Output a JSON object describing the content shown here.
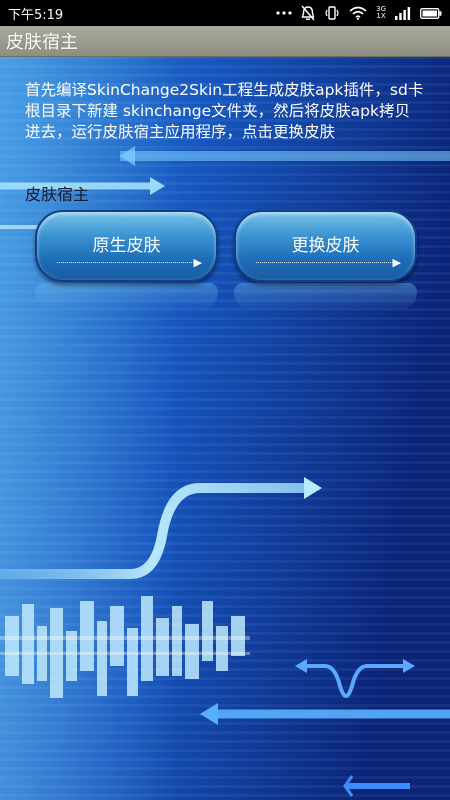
{
  "status_bar": {
    "time": "下午5:19",
    "network_label_top": "3G",
    "network_label_bottom": "1X"
  },
  "title_bar": {
    "title": "皮肤宿主"
  },
  "content": {
    "description": "首先编译SkinChange2Skin工程生成皮肤apk插件，sd卡根目录下新建 skinchange文件夹，然后将皮肤apk拷贝进去，运行皮肤宿主应用程序，点击更换皮肤",
    "host_label": "皮肤宿主"
  },
  "buttons": {
    "original_skin": "原生皮肤",
    "change_skin": "更换皮肤"
  },
  "colors": {
    "status_bar_bg": "#000000",
    "title_bar_bg": "#9a9b8c",
    "background_dark": "#0a2d8a",
    "background_light": "#2a86d8",
    "button_blue": "#3a93d2"
  }
}
